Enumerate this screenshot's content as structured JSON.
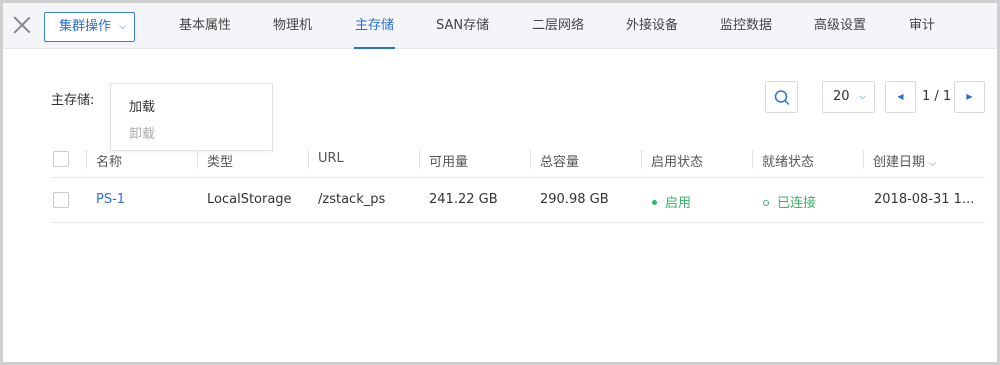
{
  "toolbar": {
    "cluster_ops_label": "集群操作",
    "tabs": [
      {
        "label": "基本属性",
        "active": false
      },
      {
        "label": "物理机",
        "active": false
      },
      {
        "label": "主存储",
        "active": true
      },
      {
        "label": "SAN存储",
        "active": false
      },
      {
        "label": "二层网络",
        "active": false
      },
      {
        "label": "外接设备",
        "active": false
      },
      {
        "label": "监控数据",
        "active": false
      },
      {
        "label": "高级设置",
        "active": false
      },
      {
        "label": "审计",
        "active": false
      }
    ]
  },
  "section": {
    "label": "主存储:",
    "menu": [
      {
        "label": "加载",
        "enabled": true
      },
      {
        "label": "卸载",
        "enabled": false
      }
    ]
  },
  "pagination": {
    "page_size": "20",
    "page_info": "1 / 1"
  },
  "table": {
    "columns": [
      "名称",
      "类型",
      "URL",
      "可用量",
      "总容量",
      "启用状态",
      "就绪状态",
      "创建日期"
    ],
    "rows": [
      {
        "name": "PS-1",
        "type": "LocalStorage",
        "url": "/zstack_ps",
        "available": "241.22 GB",
        "total": "290.98 GB",
        "enable_state": "启用",
        "ready_state": "已连接",
        "created": "2018-08-31 1..."
      }
    ]
  },
  "colors": {
    "accent": "#2a6ed6",
    "status_green": "#36b36a"
  },
  "icons": {
    "close": "close-icon",
    "search": "search-icon",
    "prev": "caret-left-icon",
    "next": "caret-right-icon",
    "dropdown": "chevron-down-icon"
  }
}
